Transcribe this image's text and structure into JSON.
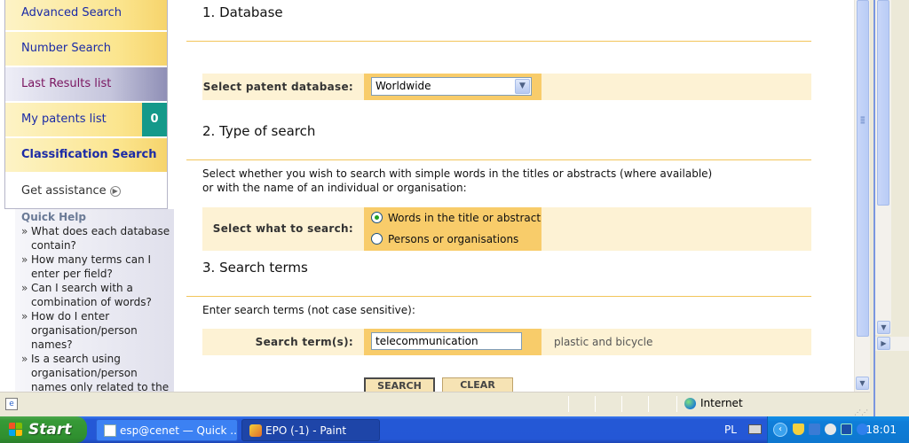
{
  "sidebar": {
    "nav": [
      {
        "label": "Advanced Search"
      },
      {
        "label": "Number Search"
      },
      {
        "label": "Last Results list"
      },
      {
        "label": "My patents list",
        "count": "0"
      },
      {
        "label": "Classification Search"
      },
      {
        "label": "Get assistance"
      }
    ],
    "quick_help": {
      "title": "Quick Help",
      "bullet": "»",
      "items": [
        "What does each database contain?",
        "How many terms can I enter per field?",
        "Can I search with a combination of words?",
        "How do I enter organisation/person names?",
        "Is a search using organisation/person names only related to the"
      ]
    }
  },
  "main": {
    "sections": [
      {
        "title": "1. Database"
      },
      {
        "title": "2. Type of search"
      },
      {
        "title": "3. Search terms"
      }
    ],
    "database": {
      "label": "Select patent database:",
      "selected": "Worldwide"
    },
    "search_type": {
      "description": "Select whether you wish to search with simple words in the titles or abstracts (where available) or with the name of an individual or organisation:",
      "label": "Select what to search:",
      "options": [
        {
          "label": "Words in the title or abstract",
          "checked": true
        },
        {
          "label": "Persons or organisations",
          "checked": false
        }
      ]
    },
    "search_terms": {
      "description": "Enter search terms (not case sensitive):",
      "label": "Search term(s):",
      "value": "telecommunication",
      "hint": "plastic and bicycle"
    },
    "buttons": {
      "search": "SEARCH",
      "clear": "CLEAR"
    }
  },
  "statusbar": {
    "zone": "Internet"
  },
  "taskbar": {
    "start": "Start",
    "tasks": [
      {
        "label": "esp@cenet — Quick ...",
        "active": true
      },
      {
        "label": "EPO (-1) - Paint",
        "active": false
      }
    ],
    "language": "PL",
    "clock": "18:01"
  },
  "colors": {
    "nav_link": "#1a2aa6",
    "section_rule": "#f2c55a",
    "form_row_bg": "#fdf2d4",
    "form_control_bg": "#f8cc6a",
    "counter_badge": "#14998a",
    "taskbar": "#2458d6",
    "start_button": "#379a37"
  }
}
